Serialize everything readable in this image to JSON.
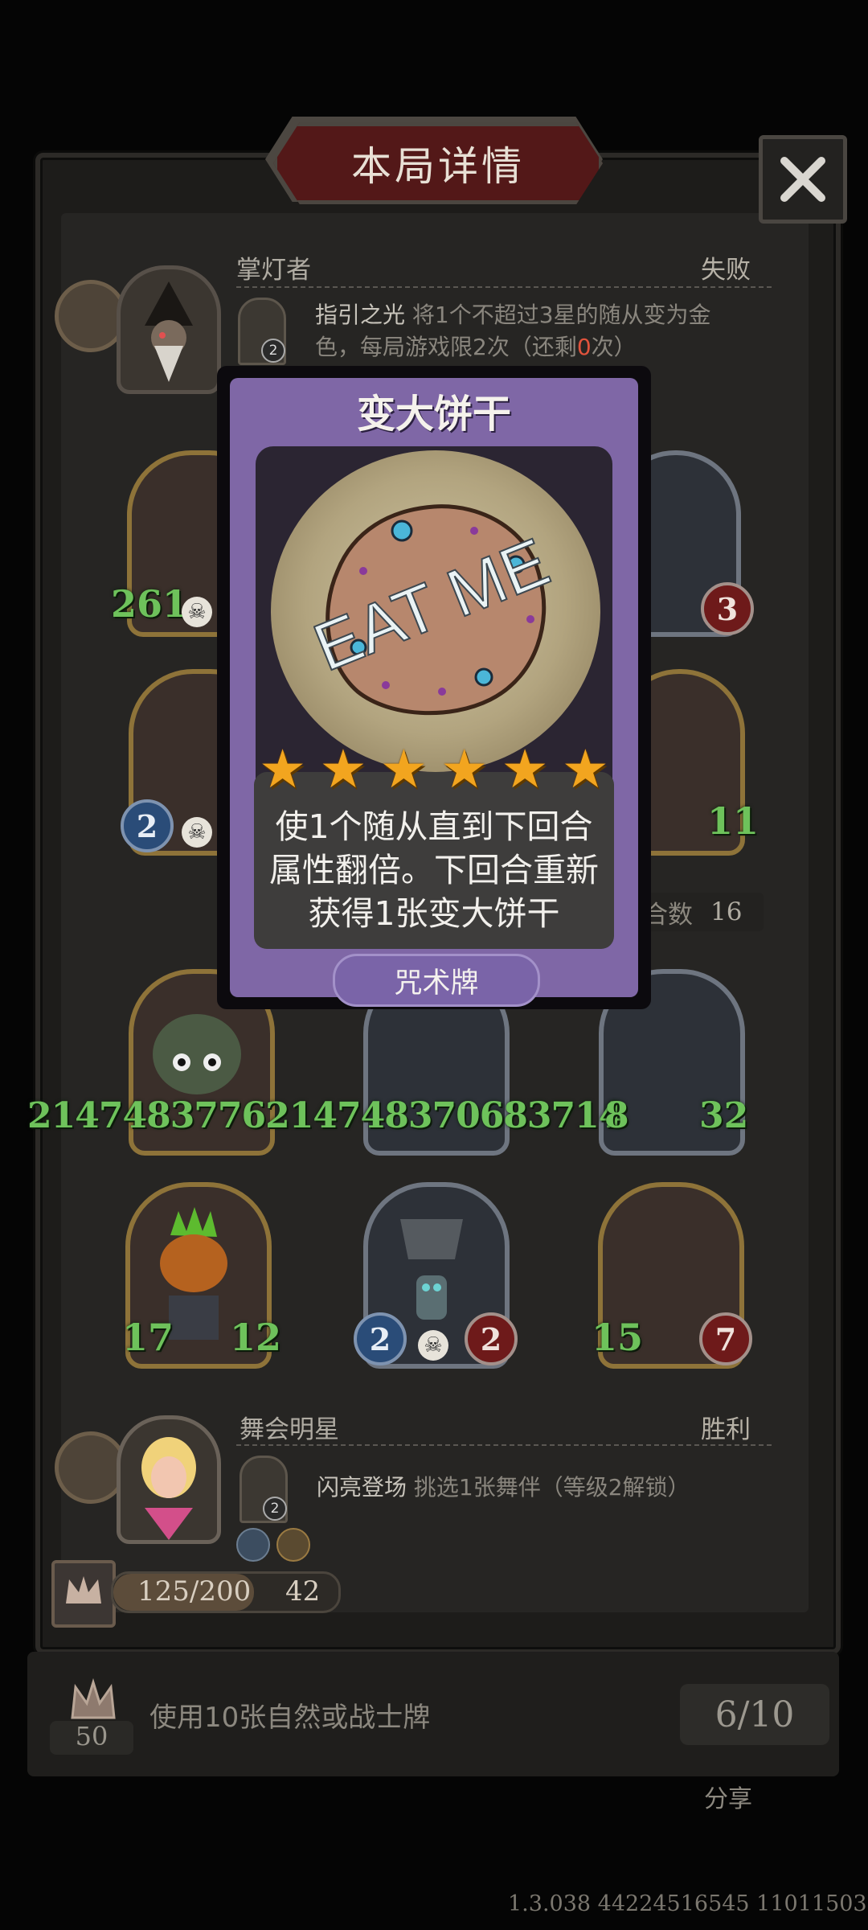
{
  "header": {
    "title": "本局详情",
    "close_icon": "close-icon"
  },
  "players": [
    {
      "name": "掌灯者",
      "result": "失败",
      "ability_name": "指引之光",
      "ability_desc_line1": " 将1个不超过3星的随从变为金",
      "ability_desc_line2_a": "色，每局游戏限2次（还剩",
      "ability_remaining": "0",
      "ability_desc_line2_b": "次）",
      "ability_level": "2"
    },
    {
      "name": "舞会明星",
      "result": "胜利",
      "ability_name": "闪亮登场",
      "ability_desc": " 挑选1张舞伴（等级2解锁）",
      "ability_level": "2",
      "exp": "125/200",
      "gold": "42"
    }
  ],
  "board": {
    "row1": {
      "left_attack": "261",
      "right_hp": "3"
    },
    "row2": {
      "left_attack": "2",
      "right_hp": "11",
      "turns_label": "合数",
      "turns_value": "16"
    },
    "row3": {
      "overflow_stats": "2147483776214748370683714",
      "mid_tail": "8",
      "right_hp": "32"
    },
    "row4": [
      {
        "attack": "17",
        "hp": "12"
      },
      {
        "attack": "2",
        "hp": "2"
      },
      {
        "attack": "15",
        "hp": "7"
      }
    ]
  },
  "popup_card": {
    "title": "变大饼干",
    "art_text": "EAT ME",
    "stars": 6,
    "description": [
      "使1个随从直到下回合",
      "属性翻倍。下回合重新",
      "获得1张变大饼干"
    ],
    "type": "咒术牌"
  },
  "quest": {
    "level": "50",
    "text": "使用10张自然或战士牌",
    "progress": "6/10"
  },
  "share_label": "分享",
  "version": "1.3.038 44224516545 11011503",
  "colors": {
    "card_purple": "#7f67a6",
    "title_red": "#531818",
    "star": "#f2a51f",
    "attack_green": "#6ec25b"
  }
}
